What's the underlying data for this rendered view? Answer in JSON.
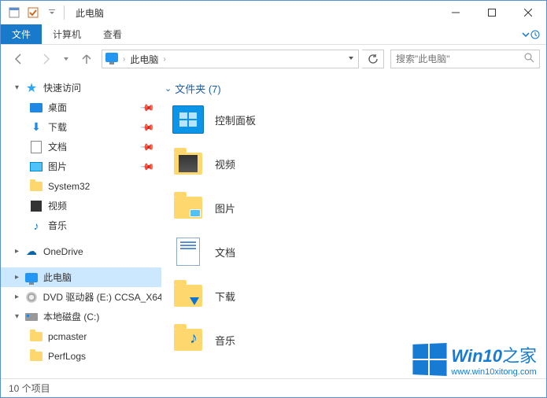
{
  "title": "此电脑",
  "ribbon": {
    "file": "文件",
    "computer": "计算机",
    "view": "查看"
  },
  "breadcrumb": {
    "root": "此电脑"
  },
  "search": {
    "placeholder": "搜索\"此电脑\""
  },
  "navpane": {
    "quick_access": "快速访问",
    "desktop": "桌面",
    "downloads": "下载",
    "documents": "文档",
    "pictures": "图片",
    "system32": "System32",
    "videos": "视频",
    "music": "音乐",
    "onedrive": "OneDrive",
    "this_pc": "此电脑",
    "dvd": "DVD 驱动器 (E:) CCSA_X64",
    "local_disk": "本地磁盘 (C:)",
    "pcmaster": "pcmaster",
    "perflogs": "PerfLogs"
  },
  "content": {
    "group_header": "文件夹 (7)",
    "items": {
      "control_panel": "控制面板",
      "videos": "视频",
      "pictures": "图片",
      "documents": "文档",
      "downloads": "下载",
      "music": "音乐"
    }
  },
  "status": "10 个项目",
  "watermark": {
    "title_a": "Win10",
    "title_b": "之家",
    "url": "www.win10xitong.com"
  }
}
